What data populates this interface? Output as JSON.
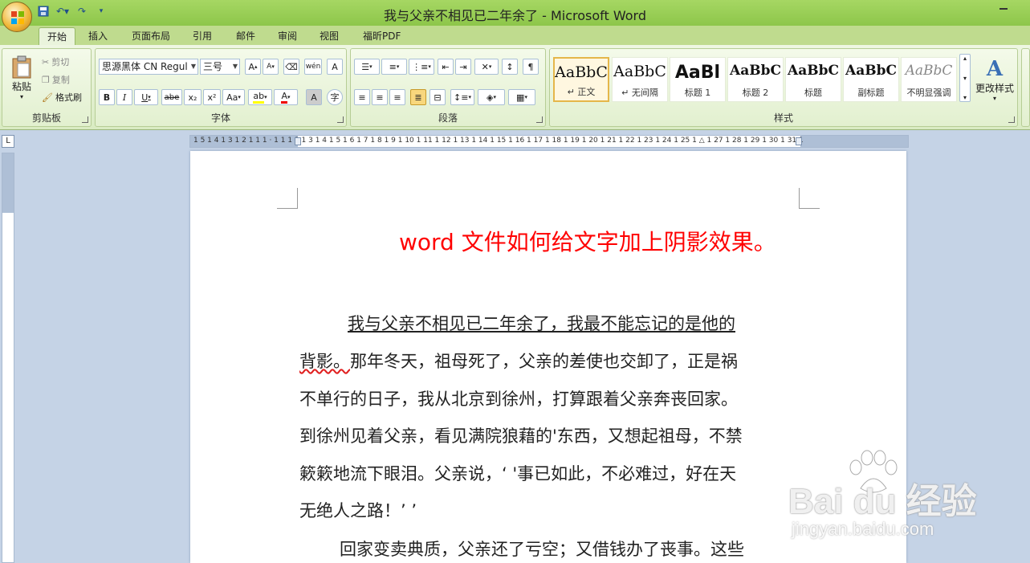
{
  "window": {
    "title": "我与父亲不相见已二年余了 - Microsoft Word"
  },
  "ribbon_tabs": [
    "开始",
    "插入",
    "页面布局",
    "引用",
    "邮件",
    "审阅",
    "视图",
    "福昕PDF"
  ],
  "clipboard": {
    "paste": "粘贴",
    "cut": "剪切",
    "copy": "复制",
    "format_painter": "格式刷",
    "group_label": "剪贴板"
  },
  "font": {
    "font_name": "思源黑体 CN Regul",
    "font_size": "三号",
    "group_label": "字体",
    "bold": "B",
    "italic": "I",
    "underline": "U",
    "strike": "abe",
    "subscript": "x₂",
    "superscript": "x²",
    "change_case": "Aa",
    "font_color_letter": "A",
    "char_shading": "A",
    "enclose": "字"
  },
  "paragraph": {
    "group_label": "段落"
  },
  "styles": {
    "items": [
      {
        "sample": "AaBbC",
        "label": "↵ 正文"
      },
      {
        "sample": "AaBbC",
        "label": "↵ 无间隔"
      },
      {
        "sample": "AaBl",
        "label": "标题 1"
      },
      {
        "sample": "AaBbC",
        "label": "标题 2"
      },
      {
        "sample": "AaBbC",
        "label": "标题"
      },
      {
        "sample": "AaBbC",
        "label": "副标题"
      },
      {
        "sample": "AaBbC",
        "label": "不明显强调"
      }
    ],
    "change_styles": "更改样式",
    "group_label": "样式"
  },
  "ruler": {
    "numbers": "1 5 1 4 1 3 1 2 1 1 1 · 1 1 1 2 1 3 1 4 1 5 1 6 1 7 1 8 1 9 1 10 1 11 1 12 1 13 1 14 1 15 1 16 1 17 1 18 1 19 1 20 1 21 1 22 1 23 1 24 1 25 1 △ 1 27 1 28 1 29 1 30 1 31 1",
    "corner": "L"
  },
  "document": {
    "title": "word 文件如何给文字加上阴影效果。",
    "line1": "我与父亲不相见已二年余了，我最不能忘记的是他的",
    "line2_wavy": "背影。",
    "line2_rest": "那年冬天，祖母死了，父亲的差使也交卸了，正是祸",
    "line3": "不单行的日子，我从北京到徐州，打算跟着父亲奔丧回家。",
    "line4": "到徐州见着父亲，看见满院狼藉的'东西，又想起祖母，不禁",
    "line5": "簌簌地流下眼泪。父亲说，‘ '事已如此，不必难过，好在天",
    "line6": "无绝人之路！’ ’",
    "line7": "回家变卖典质，父亲还了亏空；又借钱办了丧事。这些"
  },
  "watermark": {
    "main": "Bai du 经验",
    "sub": "jingyan.baidu.com"
  },
  "colors": {
    "title_red": "#ff0000",
    "ribbon_green": "#bfdb8e"
  }
}
